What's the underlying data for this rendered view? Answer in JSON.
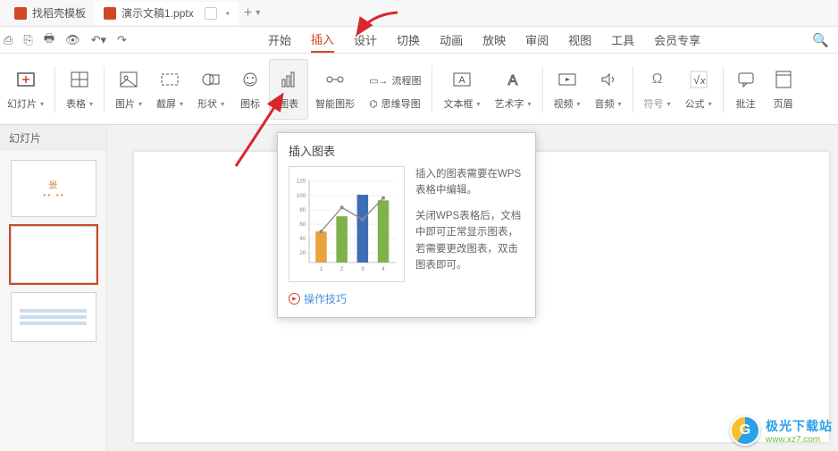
{
  "tabs": {
    "t1": "找稻壳模板",
    "t2": "演示文稿1.pptx",
    "plus": "+"
  },
  "menus": [
    "开始",
    "插入",
    "设计",
    "切换",
    "动画",
    "放映",
    "审阅",
    "视图",
    "工具",
    "会员专享"
  ],
  "active_menu_index": 1,
  "ribbon": {
    "g0": "幻灯片",
    "g1": "表格",
    "g2": "图片",
    "g3": "截屏",
    "g4": "形状",
    "g5": "图标",
    "g6": "图表",
    "g7": "智能图形",
    "g8a": "流程图",
    "g8b": "思维导图",
    "g9": "文本框",
    "g10": "艺术字",
    "g11": "视频",
    "g12": "音频",
    "g13": "符号",
    "g14": "公式",
    "g15": "批注",
    "g16": "页眉"
  },
  "side": {
    "title": "幻灯片"
  },
  "tooltip": {
    "title": "插入图表",
    "para1": "插入的图表需要在WPS表格中编辑。",
    "para2": "关闭WPS表格后，文档中即可正常显示图表，若需要更改图表，双击图表即可。",
    "link": "操作技巧",
    "link_icon": "▸"
  },
  "chart_data": {
    "type": "bar",
    "categories": [
      "1",
      "2",
      "3",
      "4"
    ],
    "bar_values": [
      45,
      67,
      98,
      90
    ],
    "line_values": [
      45,
      80,
      62,
      93
    ],
    "yticks": [
      20,
      40,
      60,
      80,
      100,
      120
    ],
    "ylim": [
      0,
      120
    ],
    "colors": {
      "bars": [
        "#e8a33d",
        "#7fb24c",
        "#3d6db5",
        "#3d6db5"
      ],
      "line": "#8a8a8a"
    }
  },
  "watermark": {
    "name": "极光下载站",
    "url": "www.xz7.com",
    "logo_letter": "G"
  }
}
